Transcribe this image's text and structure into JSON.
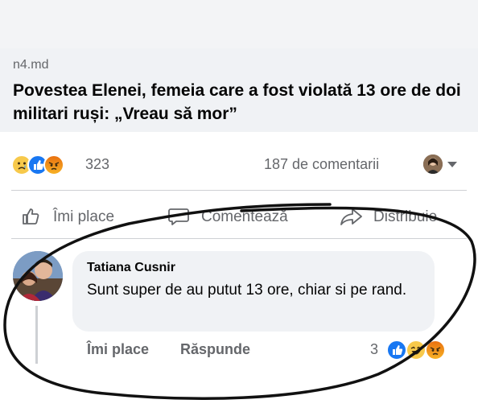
{
  "post": {
    "link": {
      "source": "n4.md",
      "headline": "Povestea Elenei, femeia care a fost violată 13 ore de doi militari ruși: „Vreau să mor”"
    },
    "reactions": {
      "icons": [
        "sad-icon",
        "like-icon",
        "angry-icon"
      ],
      "count": "323",
      "comments": "187 de comentarii"
    },
    "actions": {
      "like": "Îmi place",
      "comment": "Comentează",
      "share": "Distribuie"
    }
  },
  "comment": {
    "author": "Tatiana Cusnir",
    "text": "Sunt super de au putut 13 ore, chiar si pe rand.",
    "actions": {
      "like": "Îmi place",
      "reply": "Răspunde"
    },
    "reaction_count": "3",
    "reaction_icons": [
      "like-icon",
      "laugh-icon",
      "angry-icon"
    ]
  },
  "colors": {
    "accent": "#1877f2",
    "annotation": "#111111",
    "bubble": "#f0f2f5",
    "muted_text": "#65676b"
  }
}
